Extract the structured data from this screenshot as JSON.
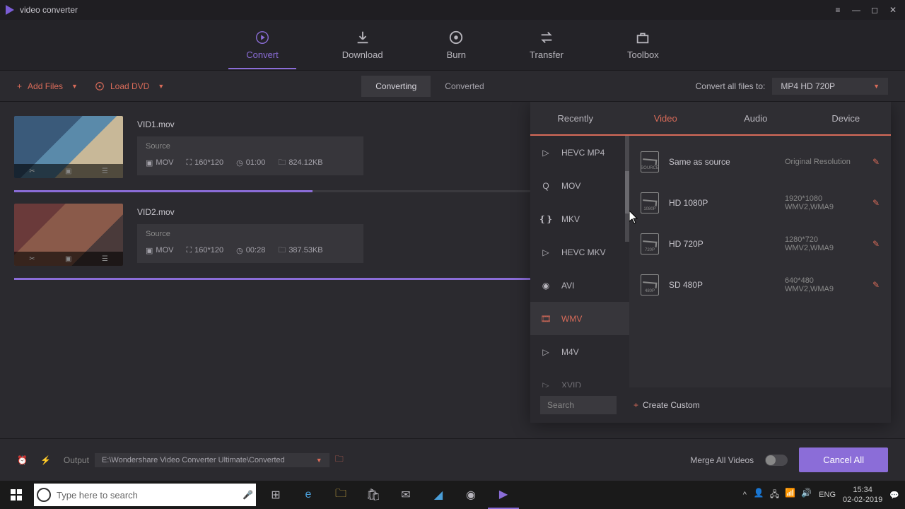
{
  "app": {
    "title": "video converter"
  },
  "main_tabs": [
    "Convert",
    "Download",
    "Burn",
    "Transfer",
    "Toolbox"
  ],
  "toolbar": {
    "add_files": "Add Files",
    "load_dvd": "Load DVD",
    "sub_tabs": [
      "Converting",
      "Converted"
    ],
    "convert_label": "Convert all files to:",
    "output_format": "MP4 HD 720P"
  },
  "files": [
    {
      "name": "VID1.mov",
      "source": "Source",
      "format": "MOV",
      "resolution": "160*120",
      "duration": "01:00",
      "size": "824.12KB",
      "progress": 34
    },
    {
      "name": "VID2.mov",
      "source": "Source",
      "format": "MOV",
      "resolution": "160*120",
      "duration": "00:28",
      "size": "387.53KB",
      "progress": 67
    }
  ],
  "popup": {
    "tabs": [
      "Recently",
      "Video",
      "Audio",
      "Device"
    ],
    "formats": [
      "HEVC MP4",
      "MOV",
      "MKV",
      "HEVC MKV",
      "AVI",
      "WMV",
      "M4V",
      "XVID"
    ],
    "qualities": [
      {
        "name": "Same as source",
        "res": "Original Resolution",
        "codec": ""
      },
      {
        "name": "HD 1080P",
        "res": "1920*1080",
        "codec": "WMV2,WMA9"
      },
      {
        "name": "HD 720P",
        "res": "1280*720",
        "codec": "WMV2,WMA9"
      },
      {
        "name": "SD 480P",
        "res": "640*480",
        "codec": "WMV2,WMA9"
      }
    ],
    "search_placeholder": "Search",
    "create_custom": "Create Custom"
  },
  "bottom": {
    "output_label": "Output",
    "output_path": "E:\\Wondershare Video Converter Ultimate\\Converted",
    "merge_label": "Merge All Videos",
    "cancel": "Cancel All"
  },
  "taskbar": {
    "search_placeholder": "Type here to search",
    "lang": "ENG",
    "time": "15:34",
    "date": "02-02-2019"
  }
}
